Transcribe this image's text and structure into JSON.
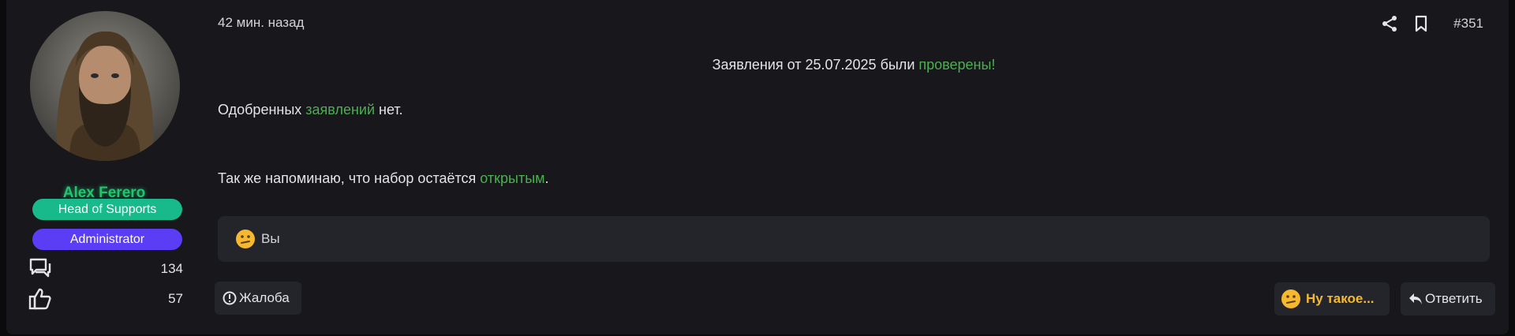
{
  "user": {
    "name": "Alex Ferero",
    "badges": [
      "Head of Supports",
      "Administrator"
    ],
    "messages_count": "134",
    "likes_count": "57",
    "avatar_icon": "bearded-man-avatar"
  },
  "post": {
    "time": "42 мин. назад",
    "number": "#351",
    "line1": {
      "before": "Заявления от 25.07.2025 были ",
      "highlight": "проверены!"
    },
    "line2": {
      "before": "Одобренных ",
      "highlight": "заявлений",
      "after": " нет."
    },
    "line3": {
      "before": "Так же напоминаю, что набор остаётся ",
      "highlight": "открытым",
      "after": "."
    }
  },
  "reactions": {
    "emoji": "confused-face-icon",
    "users": "Вы"
  },
  "actions": {
    "report_label": "Жалоба",
    "react_label": "Ну такое...",
    "reply_label": "Ответить"
  },
  "colors": {
    "background": "#17171c",
    "username": "#22c56e",
    "badge_head": "#18b98a",
    "badge_admin": "#5b3df5",
    "highlight": "#4caf50",
    "reaction": "#f5b82e"
  }
}
